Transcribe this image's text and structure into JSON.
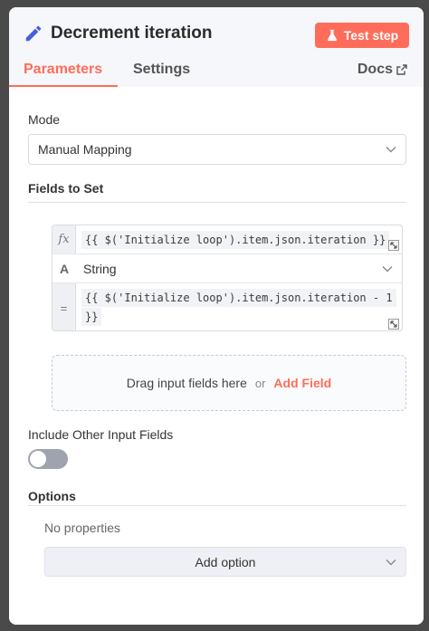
{
  "node": {
    "title": "Decrement iteration",
    "test_button": "Test step",
    "icon": "pencil-icon"
  },
  "tabs": {
    "parameters": "Parameters",
    "settings": "Settings",
    "docs": "Docs"
  },
  "mode": {
    "label": "Mode",
    "value": "Manual Mapping"
  },
  "fields_to_set": {
    "label": "Fields to Set",
    "assignment": {
      "name_gutter": "fx",
      "name_expression": "{{ $('Initialize loop').item.json.iteration }}",
      "type_glyph": "A",
      "type": "String",
      "value_gutter": "=",
      "value_line1": "{{ $('Initialize loop').item.json.iteration - 1",
      "value_line2": "}}"
    },
    "drop_text": "Drag input fields here",
    "or_text": "or",
    "add_field": "Add Field"
  },
  "include_other": {
    "label": "Include Other Input Fields",
    "enabled": false
  },
  "options": {
    "label": "Options",
    "empty_text": "No properties",
    "add_option": "Add option"
  },
  "colors": {
    "accent": "#ff6d5a",
    "toggle_off": "#9ea3ad"
  }
}
